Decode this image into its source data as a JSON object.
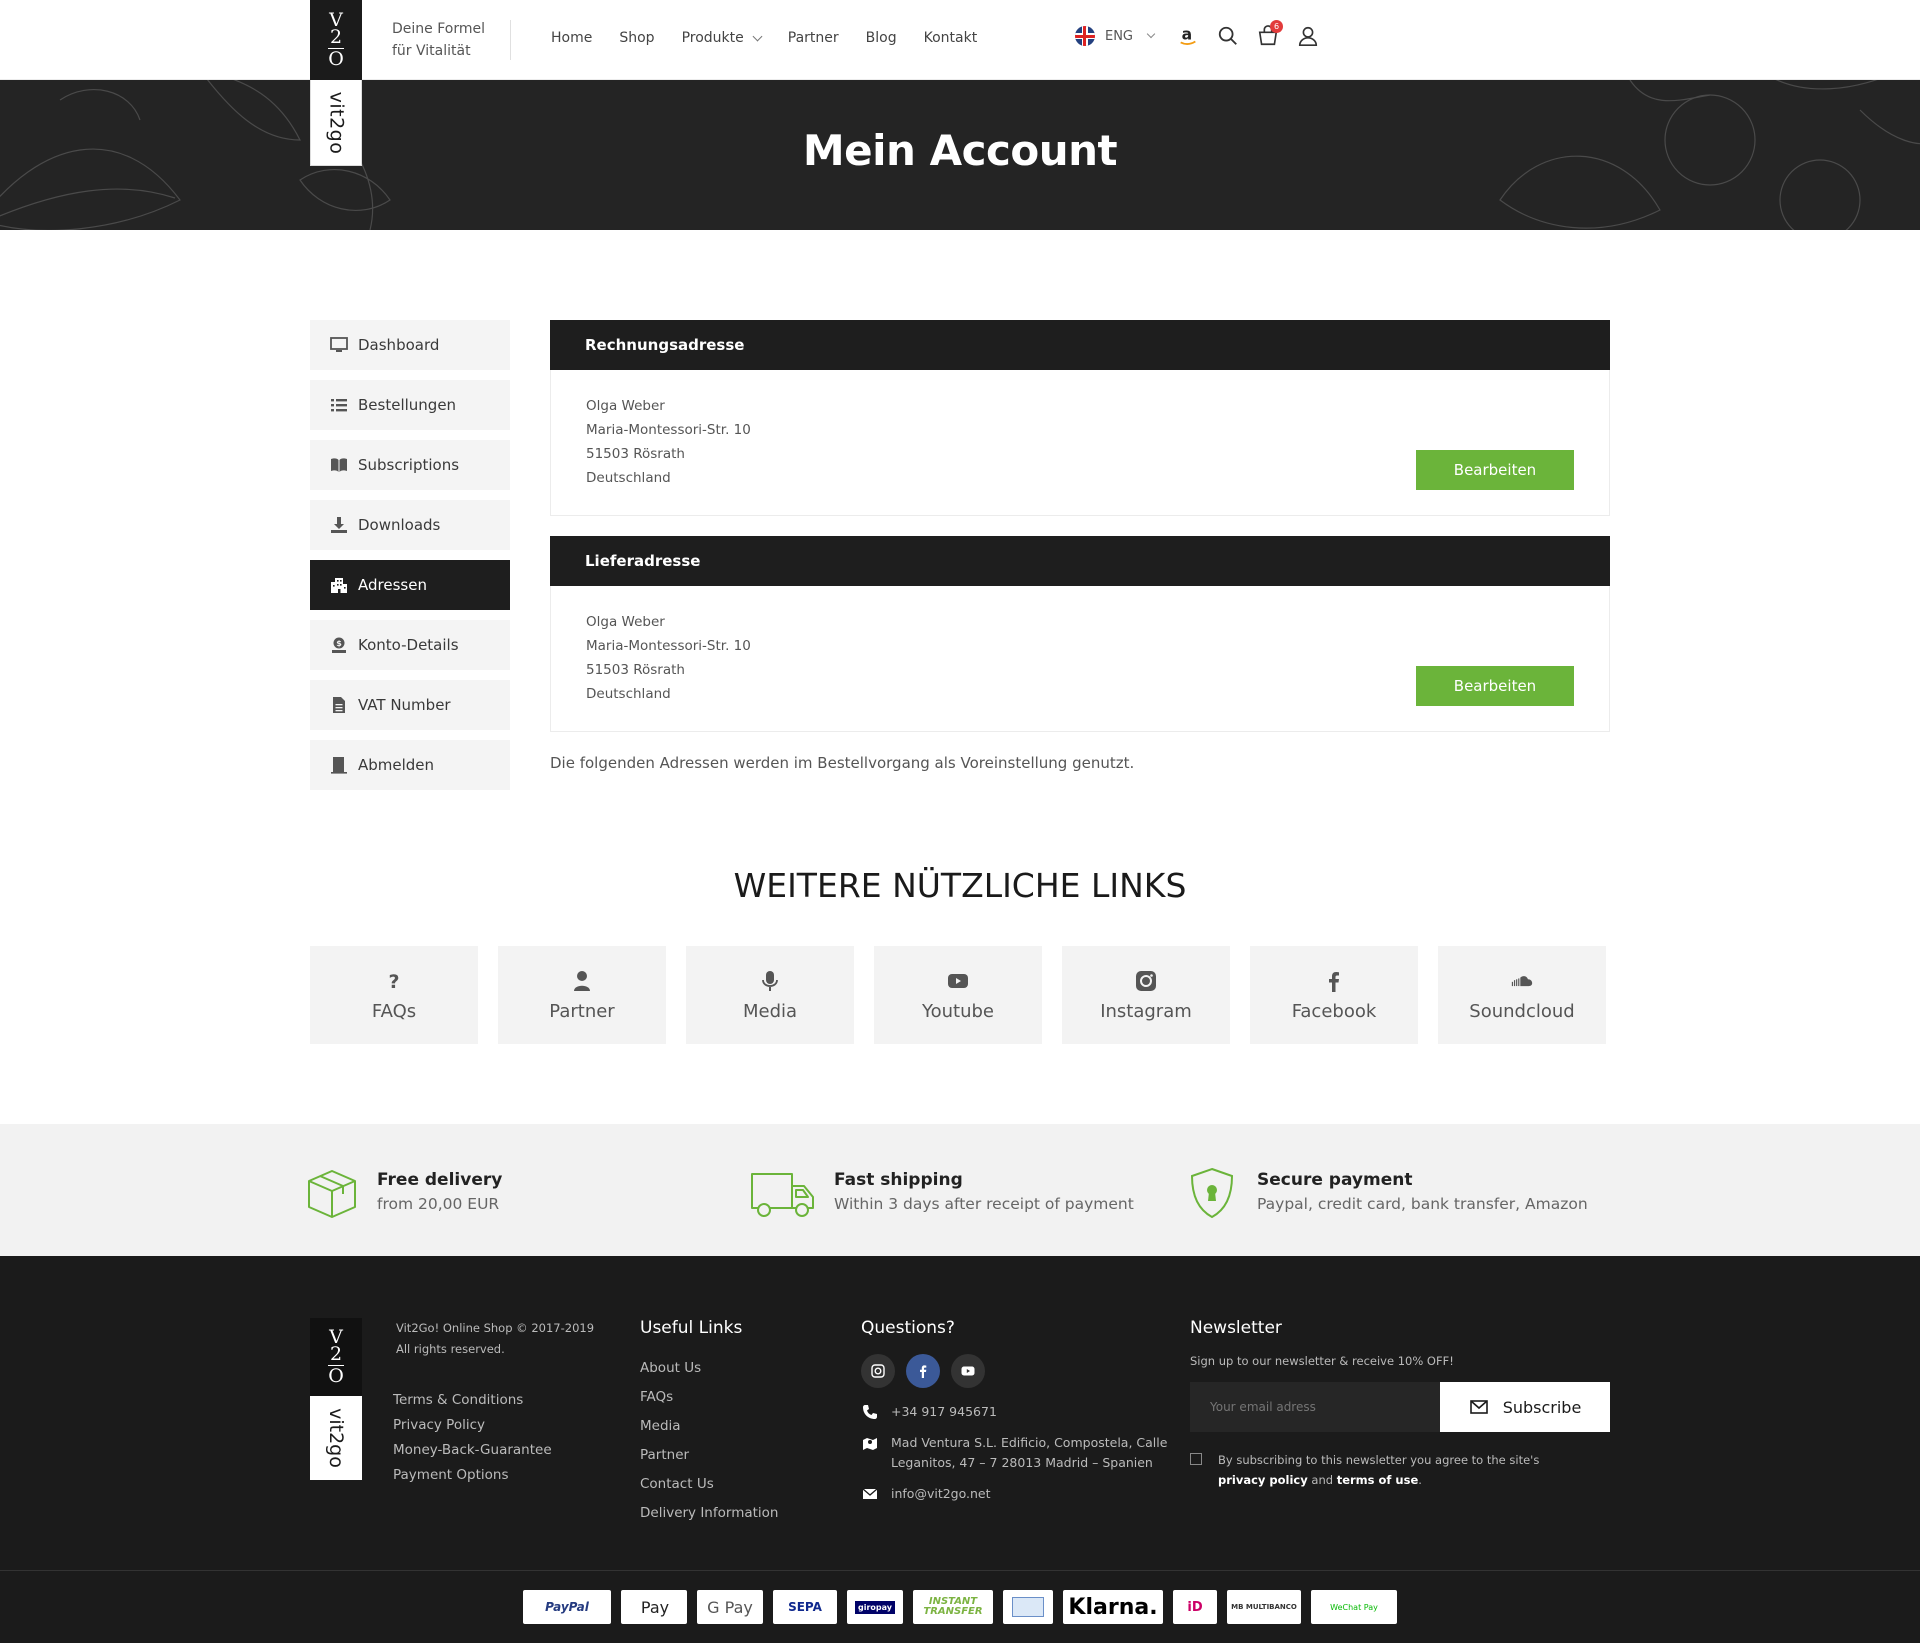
{
  "header": {
    "logo_mono_top": "V",
    "logo_mono_mid": "2",
    "logo_mono_bot": "O",
    "logo_word": "vit2go",
    "tagline_line1": "Deine Formel",
    "tagline_line2": "für Vitalität",
    "nav": [
      {
        "label": "Home"
      },
      {
        "label": "Shop"
      },
      {
        "label": "Produkte"
      },
      {
        "label": "Partner"
      },
      {
        "label": "Blog"
      },
      {
        "label": "Kontakt"
      }
    ],
    "language": "ENG",
    "cart_count": "6",
    "icons": [
      "uk-flag-icon",
      "amazon-icon",
      "search-icon",
      "cart-icon",
      "user-icon"
    ]
  },
  "hero": {
    "title": "Mein Account"
  },
  "sidebar": {
    "items": [
      {
        "label": "Dashboard",
        "icon": "monitor-icon"
      },
      {
        "label": "Bestellungen",
        "icon": "list-icon"
      },
      {
        "label": "Subscriptions",
        "icon": "book-icon"
      },
      {
        "label": "Downloads",
        "icon": "download-icon"
      },
      {
        "label": "Adressen",
        "icon": "building-icon",
        "active": true
      },
      {
        "label": "Konto-Details",
        "icon": "account-icon"
      },
      {
        "label": "VAT Number",
        "icon": "document-icon"
      },
      {
        "label": "Abmelden",
        "icon": "logout-icon"
      }
    ]
  },
  "billing": {
    "title": "Rechnungsadresse",
    "name": "Olga Weber",
    "street": "Maria-Montessori-Str. 10",
    "city": "51503 Rösrath",
    "country": "Deutschland",
    "button": "Bearbeiten"
  },
  "shipping": {
    "title": "Lieferadresse",
    "name": "Olga Weber",
    "street": "Maria-Montessori-Str. 10",
    "city": "51503 Rösrath",
    "country": "Deutschland",
    "button": "Bearbeiten"
  },
  "note": "Die folgenden Adressen werden im Bestellvorgang als Voreinstellung genutzt.",
  "useful_links": {
    "title": "WEITERE NÜTZLICHE LINKS",
    "tiles": [
      {
        "label": "FAQs",
        "icon": "question-icon"
      },
      {
        "label": "Partner",
        "icon": "person-icon"
      },
      {
        "label": "Media",
        "icon": "microphone-icon"
      },
      {
        "label": "Youtube",
        "icon": "youtube-icon"
      },
      {
        "label": "Instagram",
        "icon": "instagram-icon"
      },
      {
        "label": "Facebook",
        "icon": "facebook-icon"
      },
      {
        "label": "Soundcloud",
        "icon": "soundcloud-icon"
      }
    ]
  },
  "features": [
    {
      "title": "Free delivery",
      "text": "from 20,00 EUR",
      "icon": "box-icon"
    },
    {
      "title": "Fast shipping",
      "text": "Within 3 days after receipt of payment",
      "icon": "truck-icon"
    },
    {
      "title": "Secure payment",
      "text": "Paypal, credit card, bank transfer, Amazon",
      "icon": "shield-lock-icon"
    }
  ],
  "footer": {
    "copyright_line1": "Vit2Go! Online Shop © 2017-2019",
    "copyright_line2": "All rights reserved.",
    "legal": [
      "Terms & Conditions",
      "Privacy Policy",
      "Money-Back-Guarantee",
      "Payment Options"
    ],
    "useful_title": "Useful Links",
    "useful": [
      "About Us",
      "FAQs",
      "Media",
      "Partner",
      "Contact Us",
      "Delivery Information"
    ],
    "questions_title": "Questions?",
    "phone": "+34 917 945671",
    "address_line1": "Mad Ventura S.L. Edificio, Compostela, Calle",
    "address_line2": "Leganitos, 47 – 7 28013 Madrid – Spanien",
    "email": "info@vit2go.net",
    "newsletter_title": "Newsletter",
    "newsletter_sub": "Sign up to our newsletter & receive 10% OFF!",
    "newsletter_placeholder": "Your email adress",
    "subscribe": "Subscribe",
    "consent_pre": "By subscribing to this newsletter you agree to the site's",
    "consent_privacy": "privacy policy",
    "consent_and": "and",
    "consent_terms": "terms of use",
    "consent_end": "."
  },
  "payments": [
    "PayPal",
    " Pay",
    "G Pay",
    "SEPA",
    "giropay",
    "INSTANT TRANSFER",
    "card",
    "Klarna.",
    "iD",
    "MB MULTIBANCO",
    "WeChat Pay"
  ],
  "colors": {
    "accent_green": "#6bb43a",
    "dark": "#1e1e1e",
    "facebook": "#3b5998"
  }
}
